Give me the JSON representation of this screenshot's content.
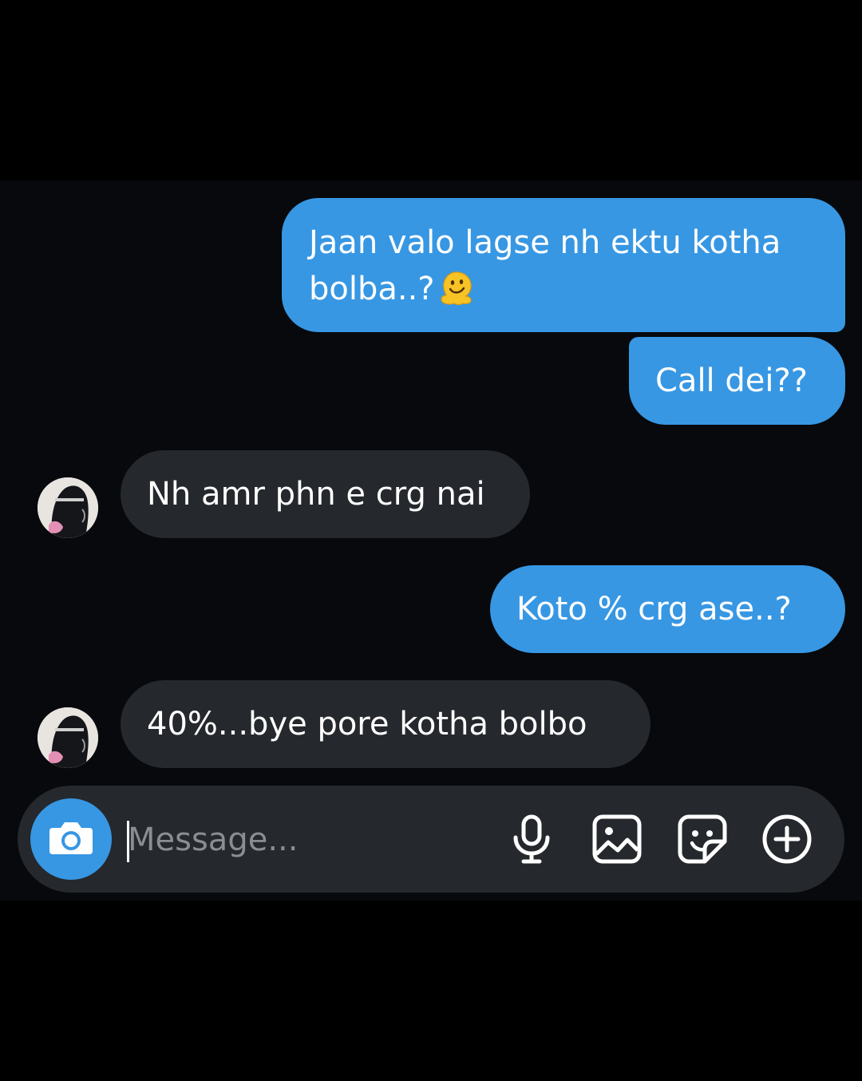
{
  "messages": [
    {
      "direction": "outgoing",
      "text_line1": "Jaan valo lagse nh ektu kotha",
      "text_line2": "bolba..?",
      "emoji": "melting-face"
    },
    {
      "direction": "outgoing",
      "text": "Call dei??"
    },
    {
      "direction": "incoming",
      "text": "Nh amr phn e crg nai"
    },
    {
      "direction": "outgoing",
      "text": "Koto % crg ase..?"
    },
    {
      "direction": "incoming",
      "text": "40%...bye pore kotha bolbo"
    }
  ],
  "composer": {
    "placeholder": "Message...",
    "value": ""
  },
  "icons": {
    "camera": "camera-icon",
    "mic": "microphone-icon",
    "gallery": "image-gallery-icon",
    "sticker": "sticker-icon",
    "plus": "plus-circle-icon"
  },
  "colors": {
    "outgoing_bubble": "#3797e3",
    "incoming_bubble": "#25282c",
    "background": "#07090c",
    "composer": "#25282c"
  }
}
